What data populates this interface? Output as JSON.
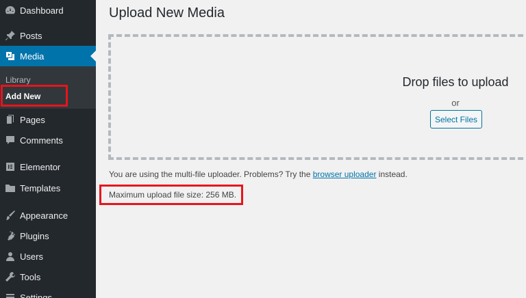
{
  "sidebar": {
    "items": [
      {
        "label": "Dashboard",
        "icon": "dashboard-icon"
      },
      {
        "label": "Posts",
        "icon": "pushpin-icon"
      },
      {
        "label": "Media",
        "icon": "media-icon"
      },
      {
        "label": "Pages",
        "icon": "pages-icon"
      },
      {
        "label": "Comments",
        "icon": "comment-icon"
      },
      {
        "label": "Elementor",
        "icon": "elementor-icon"
      },
      {
        "label": "Templates",
        "icon": "folder-icon"
      },
      {
        "label": "Appearance",
        "icon": "paintbrush-icon"
      },
      {
        "label": "Plugins",
        "icon": "plugin-icon"
      },
      {
        "label": "Users",
        "icon": "user-icon"
      },
      {
        "label": "Tools",
        "icon": "wrench-icon"
      },
      {
        "label": "Settings",
        "icon": "settings-icon"
      }
    ],
    "submenu": {
      "library": "Library",
      "add_new": "Add New"
    },
    "active_color": "#0073aa"
  },
  "main": {
    "title": "Upload New Media",
    "drop_text": "Drop files to upload",
    "or_text": "or",
    "select_button": "Select Files",
    "info_prefix": "You are using the multi-file uploader. Problems? Try the ",
    "info_link": "browser uploader",
    "info_suffix": " instead.",
    "max_size": "Maximum upload file size: 256 MB."
  },
  "highlight_color": "#e8141b"
}
